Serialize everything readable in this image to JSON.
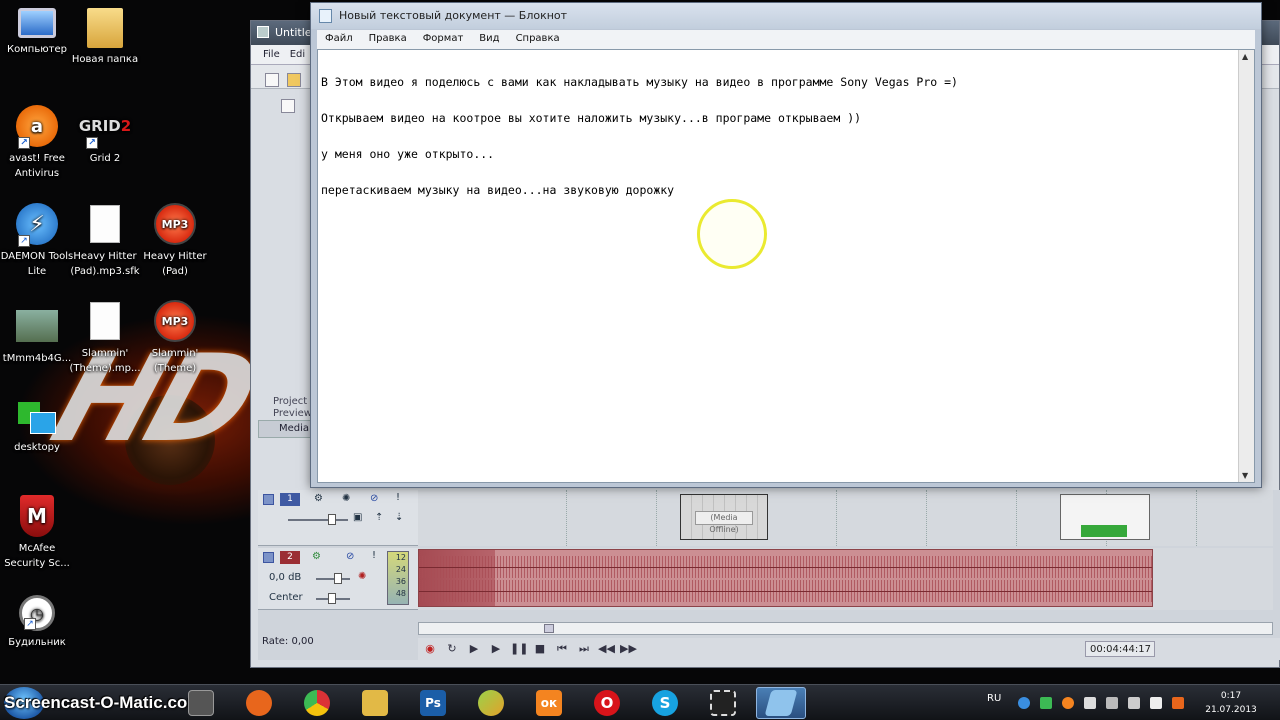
{
  "desktop": {
    "icons": [
      {
        "label": "Компьютер"
      },
      {
        "label": "Новая папка"
      },
      {
        "label": "avast! Free Antivirus"
      },
      {
        "label": "Grid 2",
        "glyph": "GRID"
      },
      {
        "label": "DAEMON Tools Lite"
      },
      {
        "label": "Heavy Hitter (Pad).mp3.sfk"
      },
      {
        "label": "Heavy Hitter (Pad)",
        "glyph": "MP3"
      },
      {
        "label": "tMmm4b4G..."
      },
      {
        "label": "Slammin' (Theme).mp..."
      },
      {
        "label": "Slammin' (Theme)",
        "glyph": "MP3"
      },
      {
        "label": "desktopy"
      },
      {
        "label": "McAfee Security Sc..."
      },
      {
        "label": "Будильник"
      }
    ],
    "wallpaper_text": "HD"
  },
  "vegas": {
    "title": "Untitled",
    "menu": [
      "File",
      "Edi"
    ],
    "side_labels": [
      "Project",
      "Preview"
    ],
    "media_tab": "Media",
    "tracks": [
      {
        "number": "1",
        "color": "#3f5aa3"
      },
      {
        "number": "2",
        "color": "#9b2e34",
        "volume": "0,0 dB",
        "pan": "Center",
        "vu_marks": [
          "12",
          "24",
          "36",
          "48"
        ]
      }
    ],
    "media_offline": "(Media Offline)",
    "rate": "Rate: 0,00",
    "timecode": "00:04:44:17"
  },
  "notepad": {
    "title": "Новый текстовый документ — Блокнот",
    "menu": [
      "Файл",
      "Правка",
      "Формат",
      "Вид",
      "Справка"
    ],
    "lines": [
      "В Этом видео я поделюсь с вами как накладывать музыку на видео в программе Sony Vegas Pro =)",
      "Открываем видео на коотрое вы хотите наложить музыку...в програме открываем ))",
      "у меня оно уже открыто...",
      "перетаскиваем музыку на видео...на звуковую дорожку"
    ]
  },
  "taskbar": {
    "watermark": "Screencast-O-Matic.com",
    "apps": [
      {
        "name": "firefox",
        "color": "#e8661c"
      },
      {
        "name": "chrome",
        "color": "#3b9a3f"
      },
      {
        "name": "explorer",
        "color": "#e2b946"
      },
      {
        "name": "photoshop",
        "color": "#1b5ea8",
        "glyph": "Ps"
      },
      {
        "name": "app-green",
        "color": "#7bc043"
      },
      {
        "name": "odnoklassniki",
        "color": "#f48420",
        "glyph": "ок"
      },
      {
        "name": "opera",
        "color": "#d8141a",
        "glyph": "O"
      },
      {
        "name": "skype",
        "color": "#17a2e0",
        "glyph": "S"
      },
      {
        "name": "screencast",
        "color": "#333"
      },
      {
        "name": "notepad",
        "color": "#8fc3ec"
      }
    ],
    "language": "RU",
    "time": "0:17",
    "date": "21.07.2013"
  }
}
